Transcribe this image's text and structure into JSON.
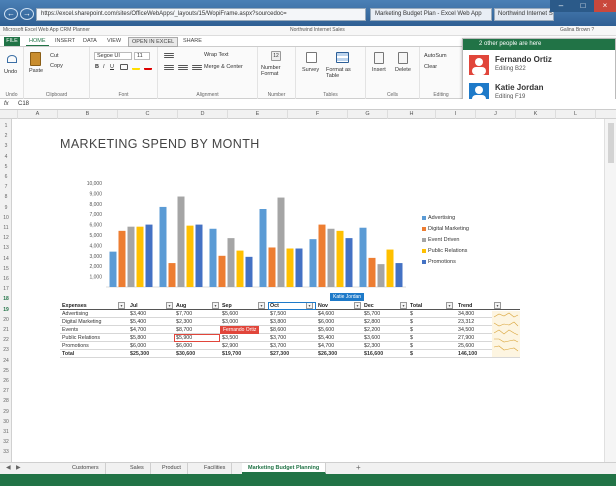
{
  "browser": {
    "address": "https://excel.sharepoint.com/sites/OfficeWebApps/_layouts/15/WopiFrame.aspx?sourcedoc=",
    "tab_active": "Marketing Budget Plan - Excel Web App",
    "tab_other": "Northwind Internet Sales",
    "back_icon": "back-arrow-icon",
    "forward_icon": "forward-arrow-icon"
  },
  "command_bar": {
    "left": "Microsoft Excel Web App   CRM Planner",
    "center": "Northwind Internet Sales",
    "right": "Galina Brown  ?"
  },
  "ribbon_tabs": {
    "file": "FILE",
    "tabs": [
      "HOME",
      "INSERT",
      "DATA",
      "VIEW",
      "OPEN IN EXCEL",
      "SHARE"
    ]
  },
  "ribbon": {
    "undo": "Undo",
    "paste": "Paste",
    "cut": "Cut",
    "copy": "Copy",
    "font_name": "Segoe UI",
    "font_size": "11",
    "wrap_text": "Wrap Text",
    "merge_center": "Merge & Center",
    "number_format": "Number Format",
    "survey": "Survey",
    "format_table": "Format as Table",
    "insert": "Insert",
    "delete": "Delete",
    "autosum": "AutoSum",
    "clear": "Clear",
    "group_clipboard": "Clipboard",
    "group_font": "Font",
    "group_alignment": "Alignment",
    "group_number": "Number",
    "group_tables": "Tables",
    "group_cells": "Cells",
    "group_editing": "Editing",
    "group_undo": "Undo"
  },
  "collab": {
    "header": "2 other people are here",
    "people": [
      {
        "name": "Fernando Ortiz",
        "status": "Editing B22",
        "color": "#e1463b"
      },
      {
        "name": "Katie Jordan",
        "status": "Editing F19",
        "color": "#1e7ac9"
      }
    ]
  },
  "formula_bar": {
    "name_box": "C18",
    "fx": "fx"
  },
  "columns": [
    "A",
    "B",
    "C",
    "D",
    "E",
    "F",
    "G",
    "H",
    "I",
    "J",
    "K",
    "L"
  ],
  "rows": [
    "1",
    "2",
    "3",
    "4",
    "5",
    "6",
    "7",
    "8",
    "9",
    "10",
    "11",
    "12",
    "13",
    "14",
    "15",
    "16",
    "17",
    "18",
    "19",
    "20",
    "21",
    "22",
    "23",
    "24",
    "25",
    "26",
    "27",
    "28",
    "29",
    "30",
    "31",
    "32",
    "33"
  ],
  "sheet_title": "MARKETING SPEND BY MONTH",
  "chart_data": {
    "type": "bar",
    "categories": [
      "Jul",
      "Aug",
      "Sep",
      "Oct",
      "Nov",
      "Dec"
    ],
    "ylim": [
      0,
      10000
    ],
    "yticks": [
      "10,000",
      "9,000",
      "8,000",
      "7,000",
      "6,000",
      "5,000",
      "4,000",
      "3,000",
      "2,000",
      "1,000"
    ],
    "series": [
      {
        "name": "Advertising",
        "color": "#5b9bd5",
        "values": [
          3400,
          7700,
          5600,
          7500,
          4600,
          5700
        ]
      },
      {
        "name": "Digital Marketing",
        "color": "#ed7d31",
        "values": [
          5400,
          2300,
          3000,
          3800,
          6000,
          2800
        ]
      },
      {
        "name": "Events",
        "color": "#a5a5a5",
        "values": [
          5800,
          8700,
          4700,
          8600,
          5600,
          2200
        ]
      },
      {
        "name": "Public Relations",
        "color": "#ffc000",
        "values": [
          5800,
          5900,
          3500,
          3700,
          5400,
          3600
        ]
      },
      {
        "name": "Promotions",
        "color": "#4472c4",
        "values": [
          6000,
          6000,
          2900,
          3700,
          4700,
          2300
        ]
      }
    ]
  },
  "legend_labels": [
    "Advertising",
    "Digital Marketing",
    "Event Driven",
    "Public Relations",
    "Promotions"
  ],
  "table": {
    "headers": [
      "Expenses",
      "Jul",
      "Aug",
      "Sep",
      "Oct",
      "Nov",
      "Dec",
      "Total",
      "Trend"
    ],
    "rows": [
      [
        "Advertising",
        "$3,400",
        "$7,700",
        "$5,600",
        "$7,500",
        "$4,600",
        "$5,700",
        "$",
        "34,800"
      ],
      [
        "Digital Marketing",
        "$5,400",
        "$2,300",
        "$3,000",
        "$3,800",
        "$6,000",
        "$2,800",
        "$",
        "23,312"
      ],
      [
        "Events",
        "$4,700",
        "$8,700",
        "$4,700",
        "$8,600",
        "$5,600",
        "$2,200",
        "$",
        "34,500"
      ],
      [
        "Public Relations",
        "$5,800",
        "$5,900",
        "$3,500",
        "$3,700",
        "$5,400",
        "$3,600",
        "$",
        "27,900"
      ],
      [
        "Promotions",
        "$6,000",
        "$6,000",
        "$2,900",
        "$3,700",
        "$4,700",
        "$2,300",
        "$",
        "25,600"
      ]
    ],
    "total": [
      "Total",
      "$25,300",
      "$30,600",
      "$19,700",
      "$27,300",
      "$26,300",
      "$16,600",
      "$",
      "146,100"
    ],
    "cursor_katie": "Katie Jordan",
    "cursor_fernando": "Fernando Ortiz"
  },
  "sheet_tabs": [
    "Customers",
    "Sales",
    "Product",
    "Facilities",
    "Marketing Budget Planning"
  ],
  "add_sheet": "+"
}
